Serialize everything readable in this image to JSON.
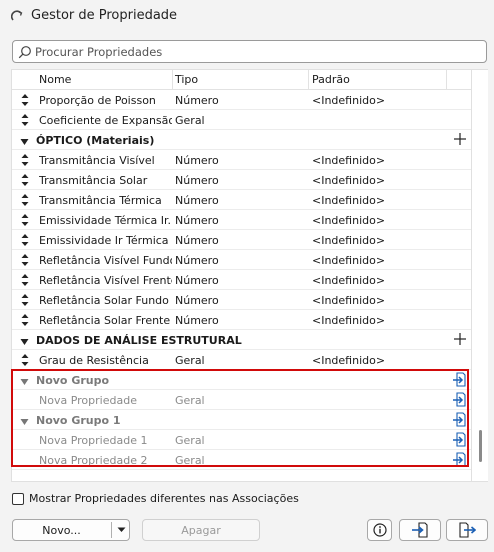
{
  "window": {
    "title": "Gestor de Propriedade"
  },
  "search": {
    "placeholder": "Procurar Propriedades"
  },
  "columns": {
    "name": "Nome",
    "type": "Tipo",
    "default": "Padrão"
  },
  "rows": [
    {
      "kind": "prop",
      "name": "Proporção de Poisson",
      "type": "Número",
      "default": "<Indefinido>"
    },
    {
      "kind": "prop",
      "name": "Coeficiente de Expansão",
      "type": "Geral",
      "default": ""
    },
    {
      "kind": "group",
      "name": "ÓPTICO (Materiais)"
    },
    {
      "kind": "prop",
      "name": "Transmitância Visível",
      "type": "Número",
      "default": "<Indefinido>"
    },
    {
      "kind": "prop",
      "name": "Transmitância Solar",
      "type": "Número",
      "default": "<Indefinido>"
    },
    {
      "kind": "prop",
      "name": "Transmitância Térmica",
      "type": "Número",
      "default": "<Indefinido>"
    },
    {
      "kind": "prop",
      "name": "Emissividade Térmica Ir...",
      "type": "Número",
      "default": "<Indefinido>"
    },
    {
      "kind": "prop",
      "name": "Emissividade Ir Térmica ...",
      "type": "Número",
      "default": "<Indefinido>"
    },
    {
      "kind": "prop",
      "name": "Refletância Visível Fundo",
      "type": "Número",
      "default": "<Indefinido>"
    },
    {
      "kind": "prop",
      "name": "Refletância Visível Frente",
      "type": "Número",
      "default": "<Indefinido>"
    },
    {
      "kind": "prop",
      "name": "Refletância Solar Fundo",
      "type": "Número",
      "default": "<Indefinido>"
    },
    {
      "kind": "prop",
      "name": "Refletância Solar Frente",
      "type": "Número",
      "default": "<Indefinido>"
    },
    {
      "kind": "group",
      "name": "DADOS DE ANÁLISE ESTRUTURAL"
    },
    {
      "kind": "prop",
      "name": "Grau de Resistência",
      "type": "Geral",
      "default": "<Indefinido>"
    },
    {
      "kind": "newgroup",
      "name": "Novo Grupo"
    },
    {
      "kind": "newprop",
      "name": "Nova Propriedade",
      "type": "Geral"
    },
    {
      "kind": "newgroup",
      "name": "Novo Grupo 1"
    },
    {
      "kind": "newprop",
      "name": "Nova Propriedade 1",
      "type": "Geral"
    },
    {
      "kind": "newprop",
      "name": "Nova Propriedade 2",
      "type": "Geral"
    }
  ],
  "footer": {
    "checkbox_label": "Mostrar Propriedades diferentes nas Associações",
    "new_label": "Novo...",
    "delete_label": "Apagar"
  },
  "colors": {
    "highlight": "#d10a0a",
    "accent": "#1a5fb4"
  }
}
